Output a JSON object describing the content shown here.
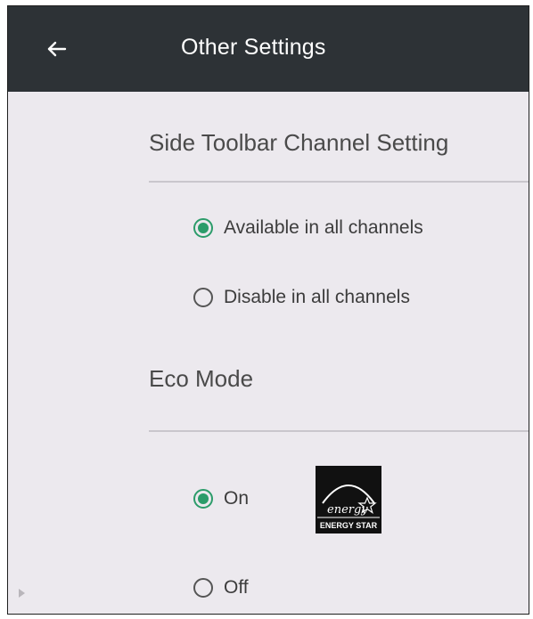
{
  "appbar": {
    "title": "Other Settings",
    "back_icon": "arrow-left-icon",
    "background": "#2d3236"
  },
  "side_toolbar": {
    "header": "Side Toolbar Channel Setting",
    "options": [
      {
        "label": "Available in all channels",
        "selected": true
      },
      {
        "label": "Disable in all channels",
        "selected": false
      }
    ]
  },
  "eco_mode": {
    "header": "Eco Mode",
    "options": [
      {
        "label": "On",
        "selected": true
      },
      {
        "label": "Off",
        "selected": false
      }
    ],
    "logo": {
      "icon": "energy-star-logo",
      "script_text": "energy",
      "caption": "ENERGY STAR"
    }
  },
  "colors": {
    "accent": "#2c9c6a",
    "page_background": "#ece9ee",
    "divider": "#c9c6cc"
  }
}
